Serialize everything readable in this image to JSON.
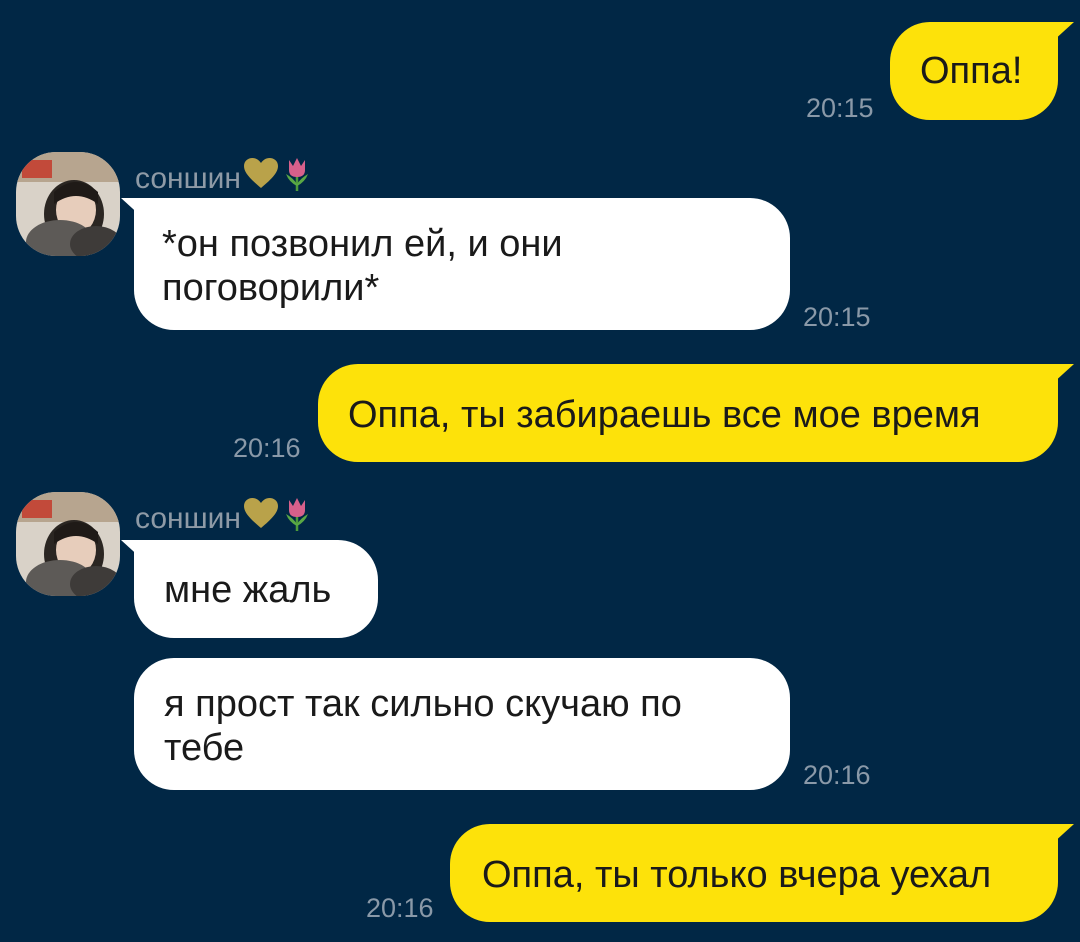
{
  "sender_name": "соншин",
  "messages": [
    {
      "direction": "out",
      "text": "Оппа!",
      "time": "20:15"
    },
    {
      "direction": "in",
      "text": "*он позвонил ей, и они\nпоговорили*",
      "time": "20:15"
    },
    {
      "direction": "out",
      "text": "Оппа, ты забираешь все мое время",
      "time": "20:16"
    },
    {
      "direction": "in",
      "text": "мне жаль",
      "time": ""
    },
    {
      "direction": "in",
      "text": "я прост так сильно скучаю по\nтебе",
      "time": "20:16"
    },
    {
      "direction": "out",
      "text": "Оппа, ты только вчера уехал",
      "time": "20:16"
    }
  ],
  "colors": {
    "background": "#012745",
    "outgoing_bubble": "#fde20a",
    "incoming_bubble": "#ffffff",
    "time_text": "#8a99a8",
    "sender_text": "#8e9aa6"
  },
  "icons": {
    "sender_emoji_1": "yellow-heart-icon",
    "sender_emoji_2": "tulip-icon"
  }
}
